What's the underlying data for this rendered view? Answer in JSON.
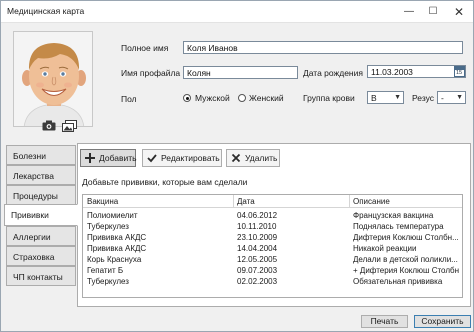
{
  "window": {
    "title": "Медицинская карта",
    "controls": {
      "minimize": "—",
      "maximize": "☐",
      "close": "✕"
    }
  },
  "form": {
    "full_name_label": "Полное имя",
    "full_name_value": "Коля Иванов",
    "username_label": "Имя профайла",
    "username_value": "Колян",
    "birth_date_label": "Дата рождения",
    "birth_date_value": "11.03.2003",
    "gender_label": "Пол",
    "gender_options": [
      "Мужской",
      "Женский"
    ],
    "gender_selected": "Мужской",
    "blood_group_label": "Группа крови",
    "blood_group_value": "B",
    "rhesus_label": "Резус",
    "rhesus_value": "-",
    "calendar_day": "15"
  },
  "tabs": [
    {
      "label": "Болезни",
      "active": false
    },
    {
      "label": "Лекарства",
      "active": false
    },
    {
      "label": "Процедуры",
      "active": false
    },
    {
      "label": "Прививки",
      "active": true
    },
    {
      "label": "Аллергии",
      "active": false
    },
    {
      "label": "Страховка",
      "active": false
    },
    {
      "label": "ЧП контакты",
      "active": false
    }
  ],
  "toolbar": {
    "add_label": "Добавить",
    "edit_label": "Редактировать",
    "delete_label": "Удалить"
  },
  "vaccinations": {
    "prompt": "Добавьте прививки, которые вам сделали",
    "columns": [
      "Вакцина",
      "Дата",
      "Описание"
    ],
    "rows": [
      [
        "Полиомиелит",
        "04.06.2012",
        "Французская вакцина"
      ],
      [
        "Туберкулез",
        "10.11.2010",
        "Поднялась температура"
      ],
      [
        "Прививка АКДС",
        "23.10.2009",
        "Дифтерия Коклюш Столбн..."
      ],
      [
        "Прививка АКДС",
        "14.04.2004",
        "Никакой реакции"
      ],
      [
        "Корь Краснуха",
        "12.05.2005",
        "Делали в детской поликли..."
      ],
      [
        "Гепатит Б",
        "09.07.2003",
        "+ Дифтерия Коклюш Столбн..."
      ],
      [
        "Туберкулез",
        "02.02.2003",
        "Обязательная прививка"
      ]
    ]
  },
  "footer": {
    "print_label": "Печать",
    "save_label": "Сохранить"
  },
  "colors": {
    "accent": "#3c7fb1",
    "tab_inactive": "#e5e5e5",
    "panel_bg": "#ffffff",
    "window_bg": "#f0f0f0"
  },
  "icons": [
    "camera-icon",
    "pictures-icon",
    "calendar-icon",
    "plus-icon",
    "check-icon",
    "x-icon",
    "dropdown-arrow-icon"
  ]
}
